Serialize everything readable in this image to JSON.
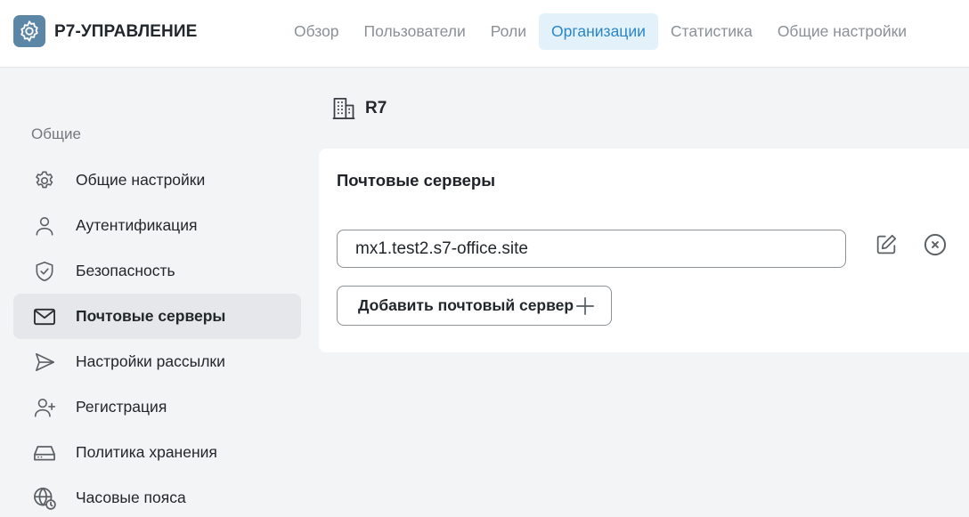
{
  "app": {
    "brand": "Р7-УПРАВЛЕНИЕ"
  },
  "nav": {
    "items": [
      {
        "label": "Обзор"
      },
      {
        "label": "Пользователи"
      },
      {
        "label": "Роли"
      },
      {
        "label": "Организации",
        "active": true
      },
      {
        "label": "Статистика"
      },
      {
        "label": "Общие настройки"
      }
    ]
  },
  "sidebar": {
    "heading": "Общие",
    "items": [
      {
        "label": "Общие настройки",
        "icon": "gear-icon"
      },
      {
        "label": "Аутентификация",
        "icon": "user-icon"
      },
      {
        "label": "Безопасность",
        "icon": "shield-check-icon"
      },
      {
        "label": "Почтовые серверы",
        "icon": "mail-icon",
        "active": true
      },
      {
        "label": "Настройки рассылки",
        "icon": "send-icon"
      },
      {
        "label": "Регистрация",
        "icon": "user-plus-icon"
      },
      {
        "label": "Политика хранения",
        "icon": "hard-drive-icon"
      },
      {
        "label": "Часовые пояса",
        "icon": "globe-clock-icon"
      }
    ]
  },
  "main": {
    "org_name": "R7",
    "card": {
      "title": "Почтовые серверы",
      "servers": [
        {
          "value": "mx1.test2.s7-office.site"
        }
      ],
      "add_button": "Добавить почтовый сервер"
    }
  },
  "colors": {
    "accent": "#2a86c9",
    "accent_bg": "#e3f1fb",
    "logo_bg": "#5b86a6",
    "page_bg": "#f3f4f6"
  }
}
